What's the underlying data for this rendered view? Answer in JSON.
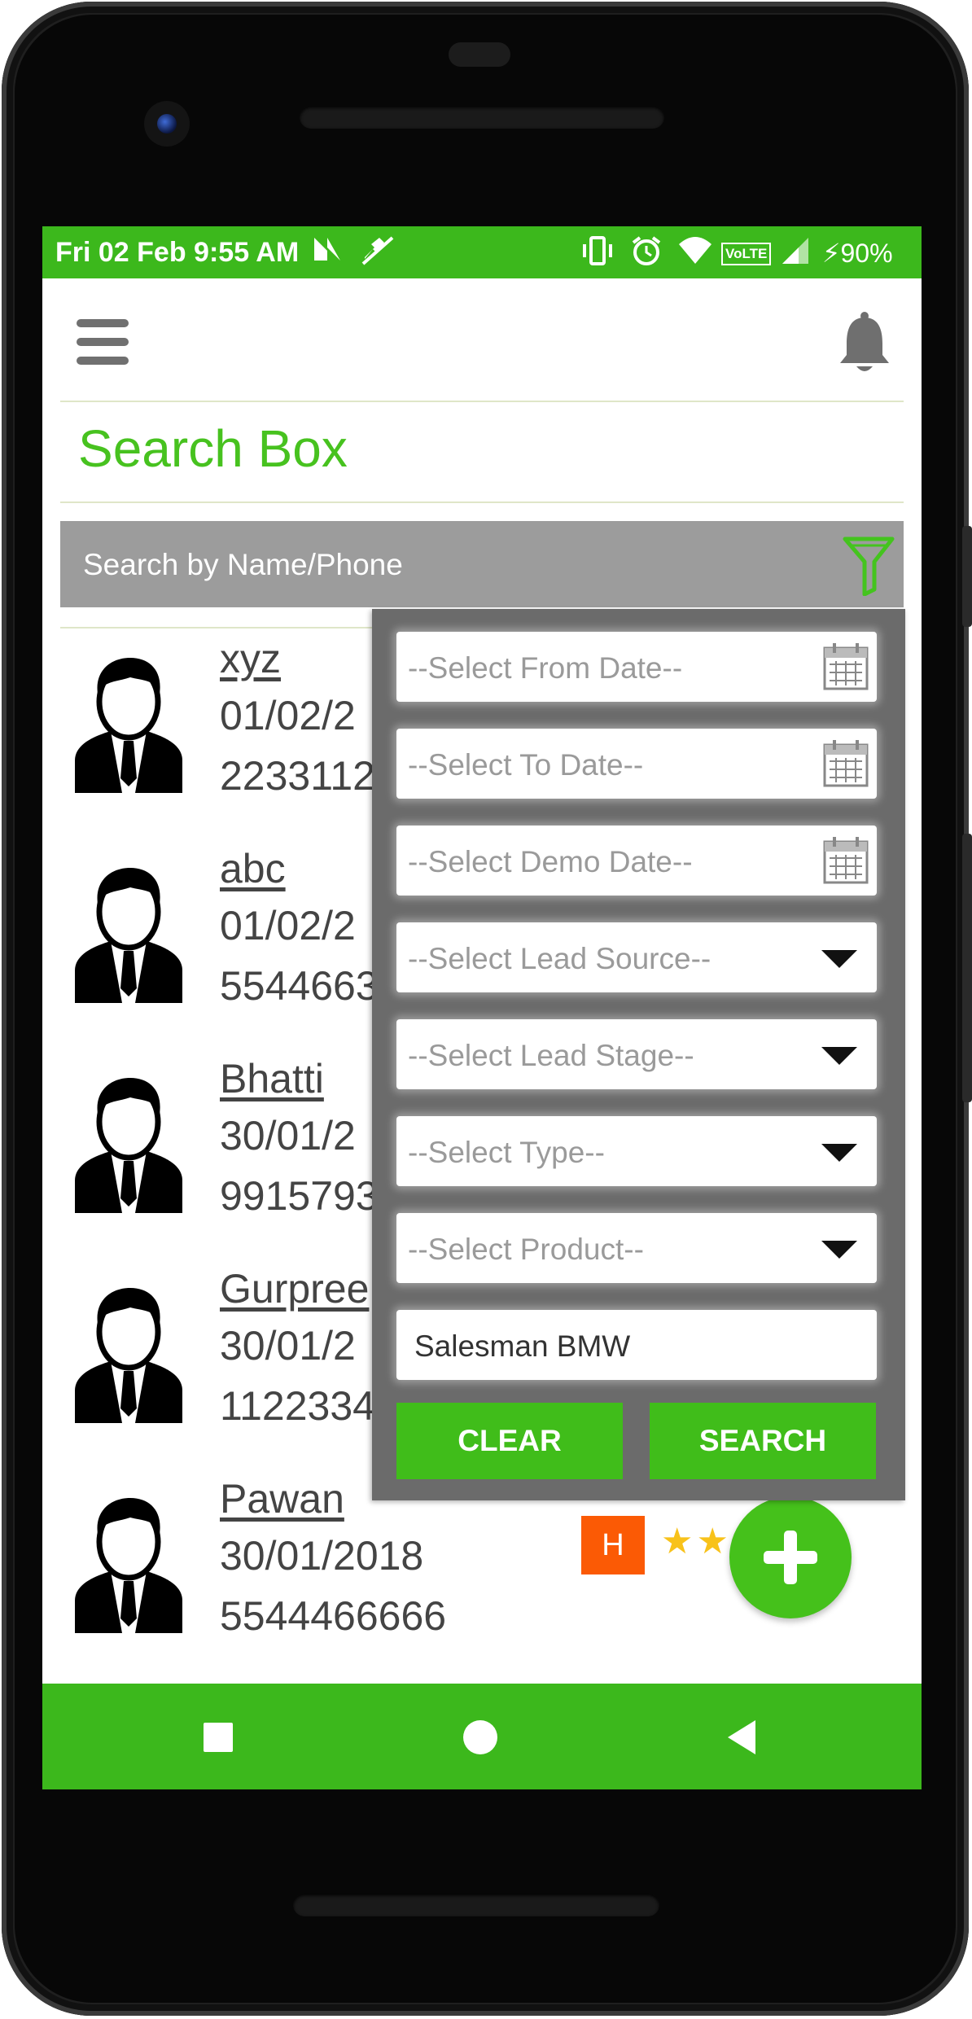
{
  "statusbar": {
    "time": "Fri 02 Feb 9:55 AM",
    "volte": "VoLTE",
    "battery": "⚡90%"
  },
  "page": {
    "title": "Search Box"
  },
  "search": {
    "placeholder": "Search by Name/Phone"
  },
  "leads": [
    {
      "name": "xyz",
      "date": "01/02/2",
      "phone": "2233112"
    },
    {
      "name": "abc",
      "date": "01/02/2",
      "phone": "5544663"
    },
    {
      "name": "Bhatti",
      "date": "30/01/2",
      "phone": "9915793"
    },
    {
      "name": "Gurpree",
      "date": "30/01/2",
      "phone": "1122334"
    },
    {
      "name": "Pawan",
      "date": "30/01/2018",
      "phone": "5544466666",
      "badge": "H",
      "stars": "★★"
    }
  ],
  "filter": {
    "from_date": "--Select From Date--",
    "to_date": "--Select To Date--",
    "demo_date": "--Select Demo Date--",
    "lead_source": "--Select Lead Source--",
    "lead_stage": "--Select Lead Stage--",
    "type": "--Select Type--",
    "product": "--Select Product--",
    "salesman": "Salesman BMW",
    "clear_label": "CLEAR",
    "search_label": "SEARCH"
  },
  "colors": {
    "brand_green": "#3cb81c",
    "title_green": "#47c21f",
    "badge_orange": "#fb5a05",
    "star_yellow": "#f8c21a",
    "panel_gray": "#6b6b6b"
  }
}
